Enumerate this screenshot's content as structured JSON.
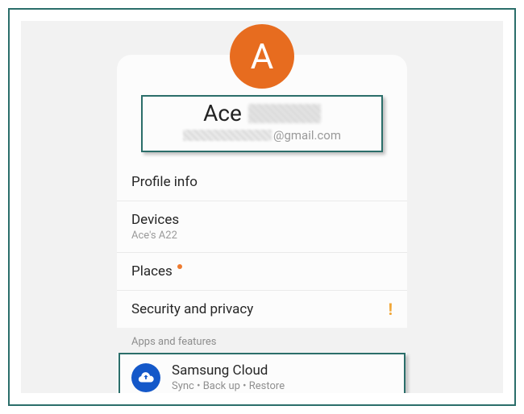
{
  "avatar": {
    "initial": "A",
    "bg": "#e76c1f"
  },
  "account": {
    "name": "Ace",
    "email_domain": "@gmail.com"
  },
  "rows": {
    "profile": {
      "title": "Profile info"
    },
    "devices": {
      "title": "Devices",
      "sub": "Ace's A22"
    },
    "places": {
      "title": "Places",
      "has_dot": true
    },
    "security": {
      "title": "Security and privacy",
      "warn": "!"
    }
  },
  "section_header": "Apps and features",
  "samsung_cloud": {
    "title": "Samsung Cloud",
    "sub": "Sync  •  Back up  •  Restore"
  }
}
